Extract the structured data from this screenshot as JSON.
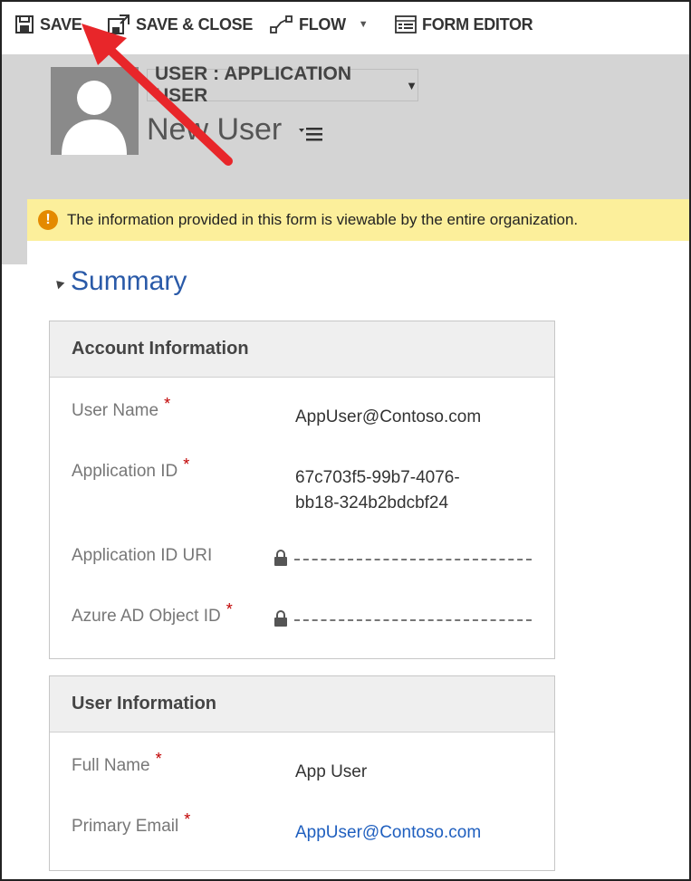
{
  "toolbar": {
    "save_label": "SAVE",
    "save_close_label": "SAVE & CLOSE",
    "flow_label": "FLOW",
    "form_editor_label": "FORM EDITOR"
  },
  "header": {
    "entity_selector": "USER : APPLICATION USER",
    "record_title": "New User"
  },
  "notification": {
    "text": "The information provided in this form is viewable by the entire organization."
  },
  "summary": {
    "title": "Summary",
    "sections": [
      {
        "title": "Account Information",
        "fields": [
          {
            "label": "User Name",
            "required": true,
            "value": "AppUser@Contoso.com"
          },
          {
            "label": "Application ID",
            "required": true,
            "value_line1": "67c703f5-99b7-4076-",
            "value_line2": "bb18-324b2bdcbf24"
          },
          {
            "label": "Application ID URI",
            "required": false,
            "locked": true,
            "value": ""
          },
          {
            "label": "Azure AD Object ID",
            "required": true,
            "locked": true,
            "value": ""
          }
        ]
      },
      {
        "title": "User Information",
        "fields": [
          {
            "label": "Full Name",
            "required": true,
            "value": "App User"
          },
          {
            "label": "Primary Email",
            "required": true,
            "value": "AppUser@Contoso.com"
          }
        ]
      }
    ]
  },
  "required_marker": "*",
  "colors": {
    "accent_link": "#1f5fbf",
    "summary_title": "#2a5aa8",
    "notification_bg": "#fcef9b",
    "warning_icon": "#e48a00",
    "required_star": "#c00000",
    "annotation_arrow": "#e8262a"
  }
}
